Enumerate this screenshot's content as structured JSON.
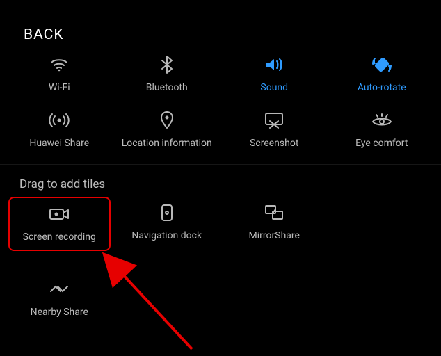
{
  "header": {
    "back": "BACK"
  },
  "row1": {
    "wifi": "Wi-Fi",
    "bluetooth": "Bluetooth",
    "sound": "Sound",
    "autorotate": "Auto-rotate"
  },
  "row2": {
    "huaweishare": "Huawei Share",
    "location": "Location information",
    "screenshot": "Screenshot",
    "eyecomfort": "Eye comfort"
  },
  "section": {
    "drag": "Drag to add tiles"
  },
  "row3": {
    "screenrecording": "Screen recording",
    "navigationdock": "Navigation dock",
    "mirrorshare": "MirrorShare"
  },
  "row4": {
    "nearbyshare": "Nearby Share"
  },
  "colors": {
    "active": "#2f9bff",
    "inactive": "#b8b8b8",
    "highlight": "#e60000"
  }
}
